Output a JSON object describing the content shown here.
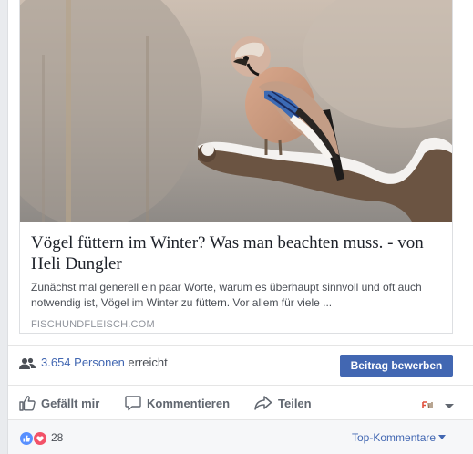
{
  "link_preview": {
    "title": "Vögel füttern im Winter? Was man beachten muss. - von Heli Dungler",
    "description": "Zunächst mal generell ein paar Worte, warum es überhaupt sinnvoll und oft auch notwendig ist, Vögel im Winter zu füttern. Vor allem für viele ...",
    "domain": "FISCHUNDFLEISCH.COM",
    "image_icon": "eurasian-jay-on-snowy-branch"
  },
  "reach": {
    "count": "3.654 Personen",
    "suffix": "erreicht",
    "boost_label": "Beitrag bewerben"
  },
  "actions": {
    "like": "Gefällt mir",
    "comment": "Kommentieren",
    "share": "Teilen"
  },
  "reactions": {
    "count": "28",
    "top_comments": "Top-Kommentare"
  },
  "colors": {
    "accent": "#4267b2",
    "like_blue": "#5890ff",
    "love_red": "#f25268"
  }
}
